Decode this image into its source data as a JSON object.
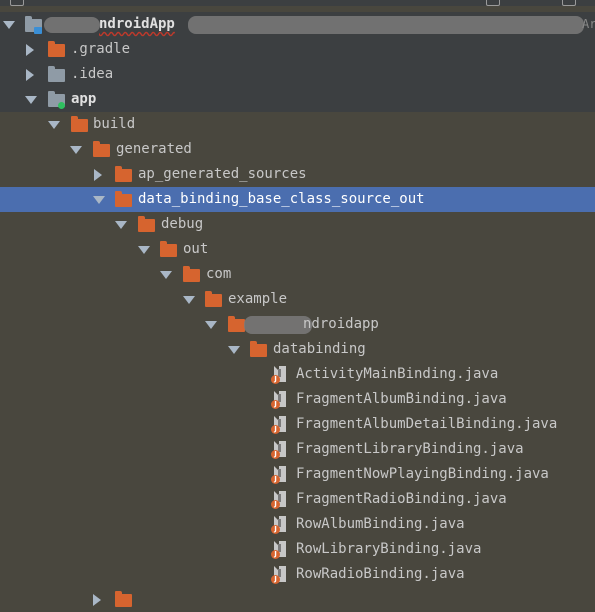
{
  "tree": {
    "root_label": "ndroidApp",
    "root_suffix": "Ar",
    "gradle": ".gradle",
    "idea": ".idea",
    "app": "app",
    "build": "build",
    "generated": "generated",
    "ap_generated_sources": "ap_generated_sources",
    "data_binding_base_class_source_out": "data_binding_base_class_source_out",
    "debug": "debug",
    "out": "out",
    "com": "com",
    "example": "example",
    "androidapp": "ndroidapp",
    "databinding": "databinding",
    "files": [
      "ActivityMainBinding.java",
      "FragmentAlbumBinding.java",
      "FragmentAlbumDetailBinding.java",
      "FragmentLibraryBinding.java",
      "FragmentNowPlayingBinding.java",
      "FragmentRadioBinding.java",
      "RowAlbumBinding.java",
      "RowLibraryBinding.java",
      "RowRadioBinding.java"
    ],
    "java_badge": "J"
  },
  "colors": {
    "background": "#49473e",
    "selection": "#4b6eaf",
    "folder": "#d6642f"
  }
}
